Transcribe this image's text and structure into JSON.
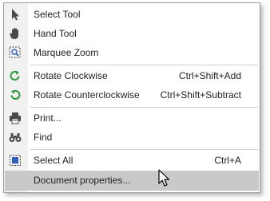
{
  "menu": {
    "items": [
      {
        "label": "Select Tool",
        "shortcut": "",
        "icon": "pointer-arrow-icon"
      },
      {
        "label": "Hand Tool",
        "shortcut": "",
        "icon": "hand-icon"
      },
      {
        "label": "Marquee Zoom",
        "shortcut": "",
        "icon": "marquee-zoom-icon"
      },
      {
        "label": "Rotate Clockwise",
        "shortcut": "Ctrl+Shift+Add",
        "icon": "rotate-clockwise-icon"
      },
      {
        "label": "Rotate Counterclockwise",
        "shortcut": "Ctrl+Shift+Subtract",
        "icon": "rotate-counterclockwise-icon"
      },
      {
        "label": "Print...",
        "shortcut": "",
        "icon": "printer-icon"
      },
      {
        "label": "Find",
        "shortcut": "",
        "icon": "binoculars-icon"
      },
      {
        "label": "Select All",
        "shortcut": "Ctrl+A",
        "icon": "select-all-icon"
      },
      {
        "label": "Document properties...",
        "shortcut": "",
        "icon": ""
      }
    ]
  },
  "colors": {
    "menu_border": "#9a9a9a",
    "gutter": "#f1f1f1",
    "hover": "#c9c9c9",
    "rotate_icon": "#2e9a3e",
    "icon_dark": "#4a4a4a",
    "select_icon_blue": "#2f5dbf"
  }
}
